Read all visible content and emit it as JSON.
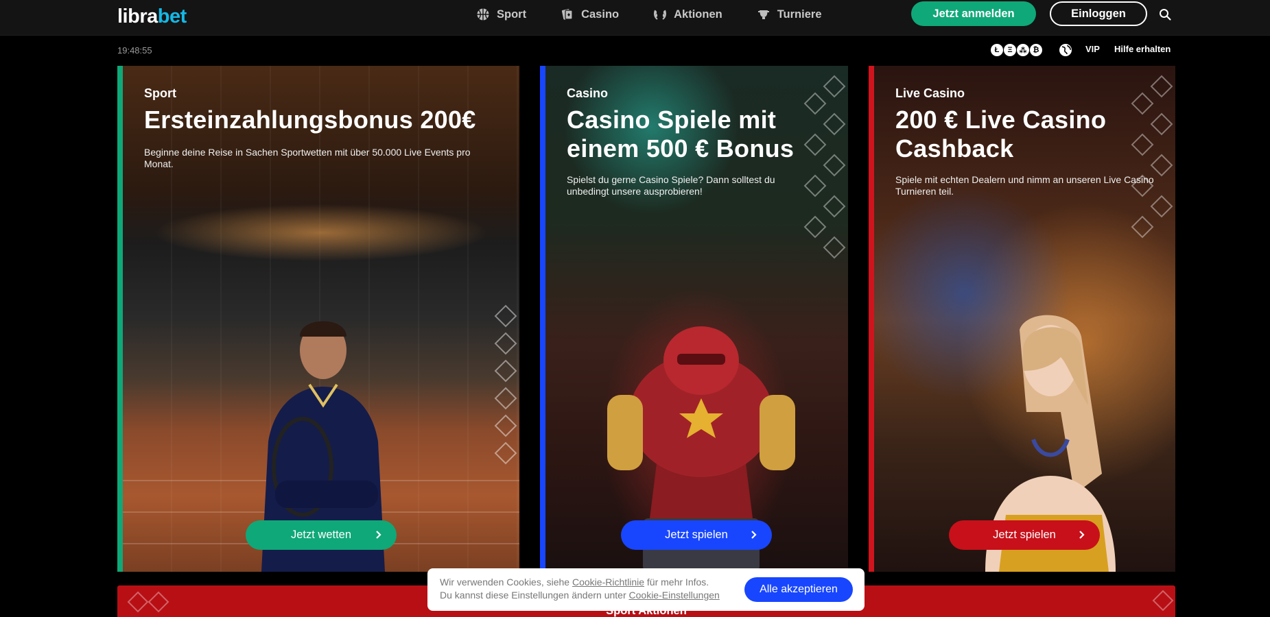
{
  "header": {
    "logo_main": "libra",
    "logo_accent": "bet",
    "nav": [
      {
        "label": "Sport",
        "icon": "basketball-icon"
      },
      {
        "label": "Casino",
        "icon": "cards-icon"
      },
      {
        "label": "Aktionen",
        "icon": "laurel-icon"
      },
      {
        "label": "Turniere",
        "icon": "trophy-icon"
      }
    ],
    "register_label": "Jetzt anmelden",
    "login_label": "Einloggen"
  },
  "subbar": {
    "clock": "19:48:55",
    "crypto": [
      "Ł",
      "Ξ",
      "⁂",
      "₿"
    ],
    "vip_label": "VIP",
    "help_label": "Hilfe erhalten"
  },
  "cards": [
    {
      "kicker": "Sport",
      "title": "Ersteinzahlungsbonus 200€",
      "desc": "Beginne deine Reise in Sachen Sportwetten mit über 50.000 Live Events pro Monat.",
      "cta": "Jetzt wetten",
      "accent": "#0fa878"
    },
    {
      "kicker": "Casino",
      "title_line1": "Casino Spiele mit",
      "title_line2": "einem 500 € Bonus",
      "desc": "Spielst du gerne Casino Spiele? Dann solltest du unbedingt unsere ausprobieren!",
      "cta": "Jetzt spielen",
      "accent": "#1846ff"
    },
    {
      "kicker": "Live Casino",
      "title_line1": "200 € Live Casino",
      "title_line2": "Cashback",
      "desc": "Spiele mit echten Dealern und nimm an unseren Live Casino Turnieren teil.",
      "cta": "Jetzt spielen",
      "accent": "#c8101a"
    }
  ],
  "bottom_banner": {
    "title": "Sport Aktionen"
  },
  "cookie": {
    "line1_pre": "Wir verwenden Cookies, siehe ",
    "line1_link": "Cookie-Richtlinie",
    "line1_post": " für mehr Infos.",
    "line2_pre": "Du kannst diese Einstellungen ändern unter ",
    "line2_link": "Cookie-Einstellungen",
    "accept_label": "Alle akzeptieren"
  }
}
